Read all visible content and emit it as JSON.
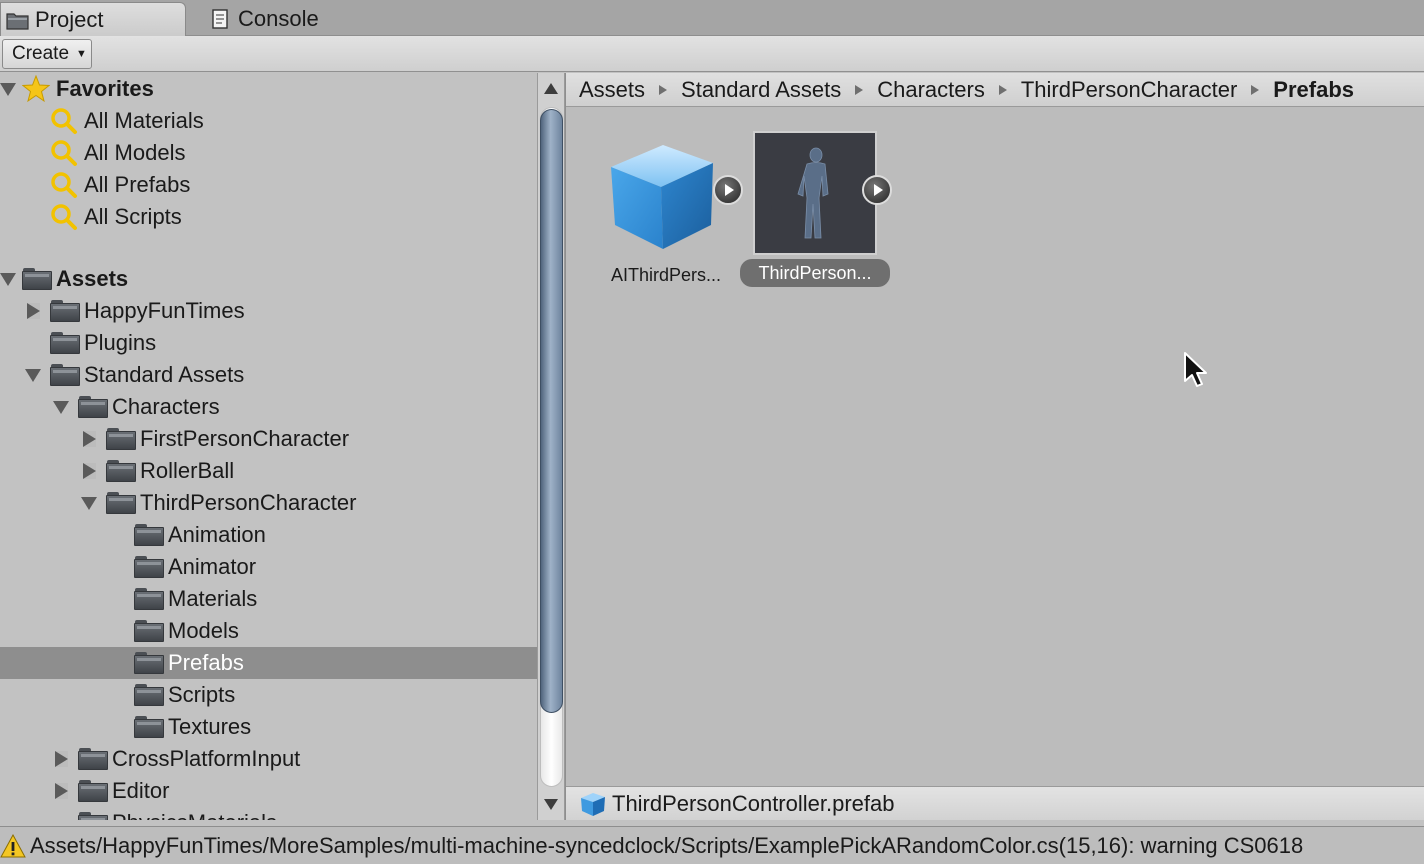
{
  "tabs": [
    {
      "label": "Project",
      "icon": "folder-icon",
      "active": true
    },
    {
      "label": "Console",
      "icon": "console-icon",
      "active": false
    }
  ],
  "toolbar": {
    "create_label": "Create"
  },
  "favorites": {
    "label": "Favorites",
    "items": [
      "All Materials",
      "All Models",
      "All Prefabs",
      "All Scripts"
    ]
  },
  "tree": {
    "root": "Assets",
    "items": [
      "HappyFunTimes",
      "Plugins",
      "Standard Assets",
      "Characters",
      "FirstPersonCharacter",
      "RollerBall",
      "ThirdPersonCharacter",
      "Animation",
      "Animator",
      "Materials",
      "Models",
      "Prefabs",
      "Scripts",
      "Textures",
      "CrossPlatformInput",
      "Editor",
      "PhysicsMaterials"
    ],
    "selected": "Prefabs"
  },
  "breadcrumb": [
    "Assets",
    "Standard Assets",
    "Characters",
    "ThirdPersonCharacter",
    "Prefabs"
  ],
  "assets": [
    {
      "label": "AIThirdPers...",
      "icon": "prefab-cube-icon",
      "selected": false
    },
    {
      "label": "ThirdPerson...",
      "icon": "character-preview-icon",
      "selected": true
    }
  ],
  "selected_file": "ThirdPersonController.prefab",
  "console_message": "Assets/HappyFunTimes/MoreSamples/multi-machine-syncedclock/Scripts/ExamplePickARandomColor.cs(15,16): warning CS0618",
  "colors": {
    "selection": "#8e8e8e",
    "thumb": "#6e849e",
    "prefab_blue": "#3f9ae0"
  }
}
